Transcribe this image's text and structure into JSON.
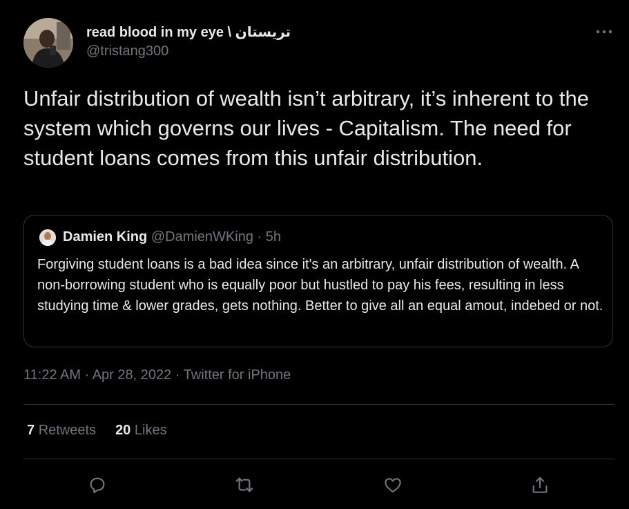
{
  "author": {
    "display_name": "read blood in my eye \\ تريستان",
    "handle": "@tristang300"
  },
  "tweet": {
    "text": "Unfair distribution of wealth isn’t arbitrary, it’s inherent to the system which governs our lives - Capitalism. The need for student loans comes from this unfair distribution."
  },
  "quoted_tweet": {
    "name": "Damien King",
    "handle": "@DamienWKing",
    "separator": " · ",
    "time": "5h",
    "text": "Forgiving student loans is a bad idea since it's an arbitrary, unfair distribution of wealth. A non-borrowing student who is equally poor but hustled to pay his fees, resulting in less studying time & lower grades, gets nothing. Better to give all an equal amout, indebed or not."
  },
  "meta": {
    "time": "11:22 AM",
    "separator": " · ",
    "date": "Apr 28, 2022",
    "source": "Twitter for iPhone"
  },
  "stats": {
    "retweets_count": "7",
    "retweets_label": "Retweets",
    "likes_count": "20",
    "likes_label": "Likes"
  },
  "icons": {
    "more": "more-horizontal-icon",
    "reply": "reply-icon",
    "retweet": "retweet-icon",
    "like": "like-icon",
    "share": "share-icon"
  },
  "colors": {
    "background": "#000000",
    "text_primary": "#e7e9ea",
    "text_secondary": "#71767b",
    "border": "#2f3336"
  }
}
